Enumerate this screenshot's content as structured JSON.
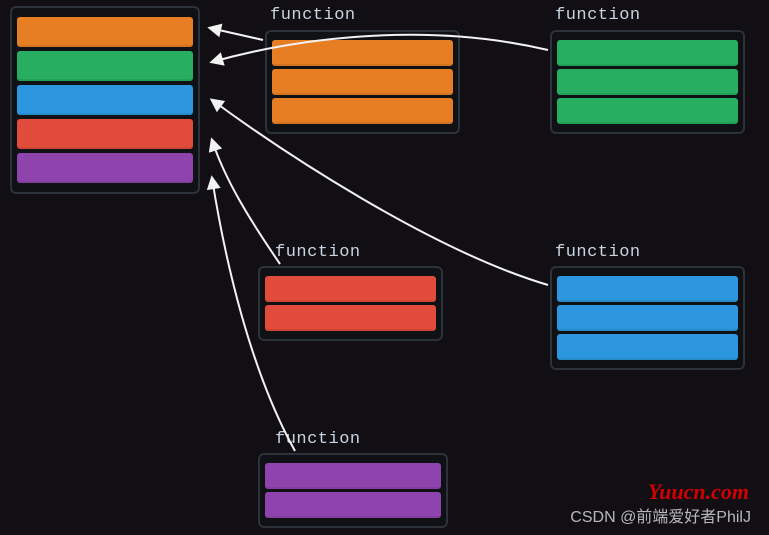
{
  "target": {
    "rows": [
      "orange",
      "green",
      "blue",
      "red",
      "purple"
    ]
  },
  "functions": {
    "orange": {
      "label": "function",
      "rows": 3,
      "color": "orange"
    },
    "green": {
      "label": "function",
      "rows": 3,
      "color": "green"
    },
    "red": {
      "label": "function",
      "rows": 2,
      "color": "red"
    },
    "blue": {
      "label": "function",
      "rows": 3,
      "color": "blue"
    },
    "purple": {
      "label": "function",
      "rows": 2,
      "color": "purple"
    }
  },
  "arrows": [
    {
      "from": "fn-orange",
      "to_row": 0
    },
    {
      "from": "fn-green",
      "to_row": 1
    },
    {
      "from": "fn-blue",
      "to_row": 2
    },
    {
      "from": "fn-red",
      "to_row": 3
    },
    {
      "from": "fn-purple",
      "to_row": 4
    }
  ],
  "watermarks": {
    "site": "Yuucn.com",
    "attribution": "CSDN @前端爱好者PhilJ"
  }
}
